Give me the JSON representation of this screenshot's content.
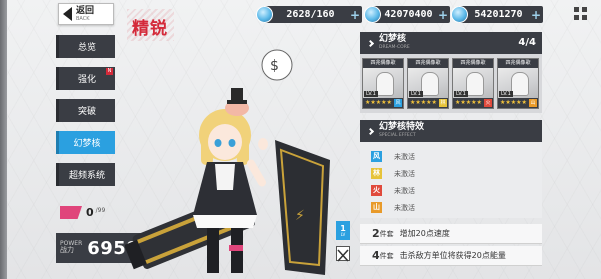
{
  "header": {
    "back_cn": "返回",
    "back_en": "BACK",
    "title": "精锐"
  },
  "resources": [
    {
      "icon": "gem-icon",
      "value": "2628/160",
      "plus": "+"
    },
    {
      "icon": "crystal-icon",
      "value": "42070400",
      "plus": "+"
    },
    {
      "icon": "diamond-icon",
      "value": "54201270",
      "plus": "+"
    }
  ],
  "menu": {
    "items": [
      {
        "label": "总览"
      },
      {
        "label": "强化",
        "badge": "N"
      },
      {
        "label": "突破"
      },
      {
        "label": "幻梦核"
      },
      {
        "label": "超频系统"
      }
    ],
    "active_index": 3
  },
  "stats": {
    "affection": "0",
    "affection_max": "/99",
    "power_en": "POWER",
    "power_cn": "战力",
    "power_value": "6958",
    "level_label": "LV",
    "level_value": "1"
  },
  "cores_panel": {
    "title_cn": "幻梦核",
    "title_en": "DREAM-CORE",
    "count": "4/4",
    "cores": [
      {
        "name": "四兆偶像歌",
        "level": "LV.1",
        "tag": "风",
        "tag_color": "#2ba0e0"
      },
      {
        "name": "四兆偶像歌",
        "level": "LV.1",
        "tag": "林",
        "tag_color": "#e6c33a"
      },
      {
        "name": "四兆偶像歌",
        "level": "LV.1",
        "tag": "火",
        "tag_color": "#e04a3c"
      },
      {
        "name": "四兆偶像歌",
        "level": "LV.1",
        "tag": "山",
        "tag_color": "#e89a2a"
      }
    ]
  },
  "effects_panel": {
    "title_cn": "幻梦核特效",
    "title_en": "SPECIAL EFFECT",
    "effects": [
      {
        "tag": "风",
        "color": "#2ba0e0",
        "text": "未激活"
      },
      {
        "tag": "林",
        "color": "#e6c33a",
        "text": "未激活"
      },
      {
        "tag": "火",
        "color": "#e04a3c",
        "text": "未激活"
      },
      {
        "tag": "山",
        "color": "#e89a2a",
        "text": "未激活"
      }
    ],
    "sets": [
      {
        "count": "2",
        "unit": "件套",
        "desc": "增加20点速度"
      },
      {
        "count": "4",
        "unit": "件套",
        "desc": "击杀敌方单位将获得20点能量"
      }
    ]
  }
}
